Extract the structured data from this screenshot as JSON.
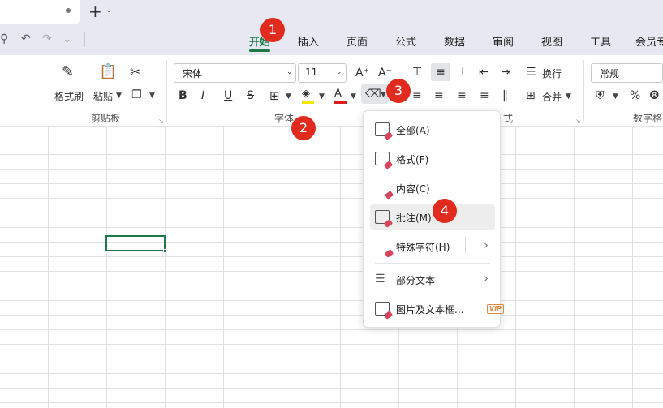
{
  "titlebar": {
    "new_tab_icon": "+",
    "new_tab_menu_icon": "chevron-down-icon"
  },
  "quick_access": {
    "icons": [
      "print-preview-icon",
      "undo-icon",
      "redo-icon",
      "chevron-down-icon"
    ]
  },
  "menu": {
    "items": [
      "开始",
      "插入",
      "页面",
      "公式",
      "数据",
      "审阅",
      "视图",
      "工具",
      "会员专"
    ],
    "active": "开始"
  },
  "ribbon": {
    "clipboard": {
      "format_painter_label": "格式刷",
      "paste_label": "粘贴",
      "group_name": "剪贴板",
      "icons": [
        "format-painter-icon",
        "paste-icon",
        "cut-icon",
        "copy-icon"
      ]
    },
    "font": {
      "font_name": "宋体",
      "font_size": "11",
      "group_name": "字体",
      "grow_label": "A⁺",
      "shrink_label": "A⁻",
      "bold_label": "B",
      "italic_label": "I",
      "underline_label": "U",
      "strike_label": "S"
    },
    "alignment": {
      "wrap_label": "换行",
      "merge_label": "合并",
      "group_name_partial": "式"
    },
    "number": {
      "format_value": "常规",
      "percent_label": "%",
      "group_name_partial": "数字格"
    }
  },
  "dropdown": {
    "items": [
      {
        "label": "全部(A)",
        "icon": "clear-all-icon"
      },
      {
        "label": "格式(F)",
        "icon": "clear-format-icon"
      },
      {
        "label": "内容(C)",
        "icon": "clear-content-icon"
      },
      {
        "label": "批注(M)",
        "icon": "clear-comment-icon"
      },
      {
        "label": "特殊字符(H)",
        "icon": "clear-special-chars-icon"
      },
      {
        "label": "部分文本",
        "icon": "partial-text-icon"
      },
      {
        "label": "图片及文本框...",
        "icon": "image-textbox-icon"
      }
    ],
    "vip_label": "VIP"
  },
  "badges": [
    "1",
    "2",
    "3",
    "4"
  ],
  "colors": {
    "accent": "#1b7a47",
    "badge": "#e02b1e",
    "highlight_yellow": "#f5e400",
    "font_red": "#d81e1e"
  }
}
